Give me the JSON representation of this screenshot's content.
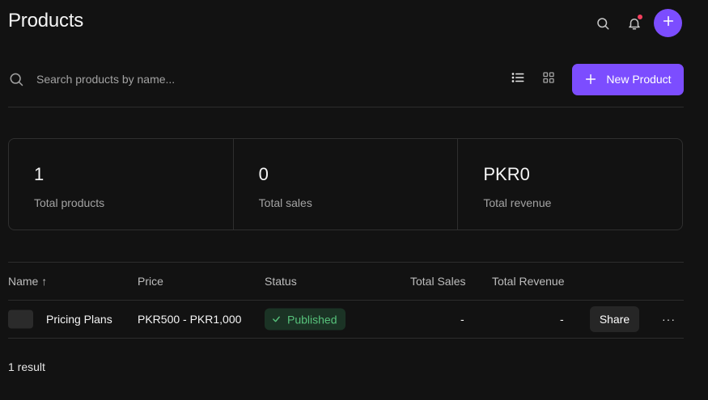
{
  "header": {
    "title": "Products"
  },
  "search": {
    "placeholder": "Search products by name..."
  },
  "toolbar": {
    "new_product_label": "New Product"
  },
  "stats": [
    {
      "value": "1",
      "label": "Total products"
    },
    {
      "value": "0",
      "label": "Total sales"
    },
    {
      "value": "PKR0",
      "label": "Total revenue"
    }
  ],
  "table": {
    "columns": {
      "name": "Name ↑",
      "price": "Price",
      "status": "Status",
      "total_sales": "Total Sales",
      "total_revenue": "Total Revenue"
    },
    "rows": [
      {
        "name": "Pricing Plans",
        "price": "PKR500 - PKR1,000",
        "status": "Published",
        "total_sales": "-",
        "total_revenue": "-",
        "share_label": "Share",
        "more_label": "···"
      }
    ]
  },
  "footer": {
    "result_count": "1 result"
  },
  "colors": {
    "accent": "#7c4dff",
    "notification": "#f43f5e",
    "published_text": "#57c27b",
    "published_bg": "#1b3325"
  }
}
